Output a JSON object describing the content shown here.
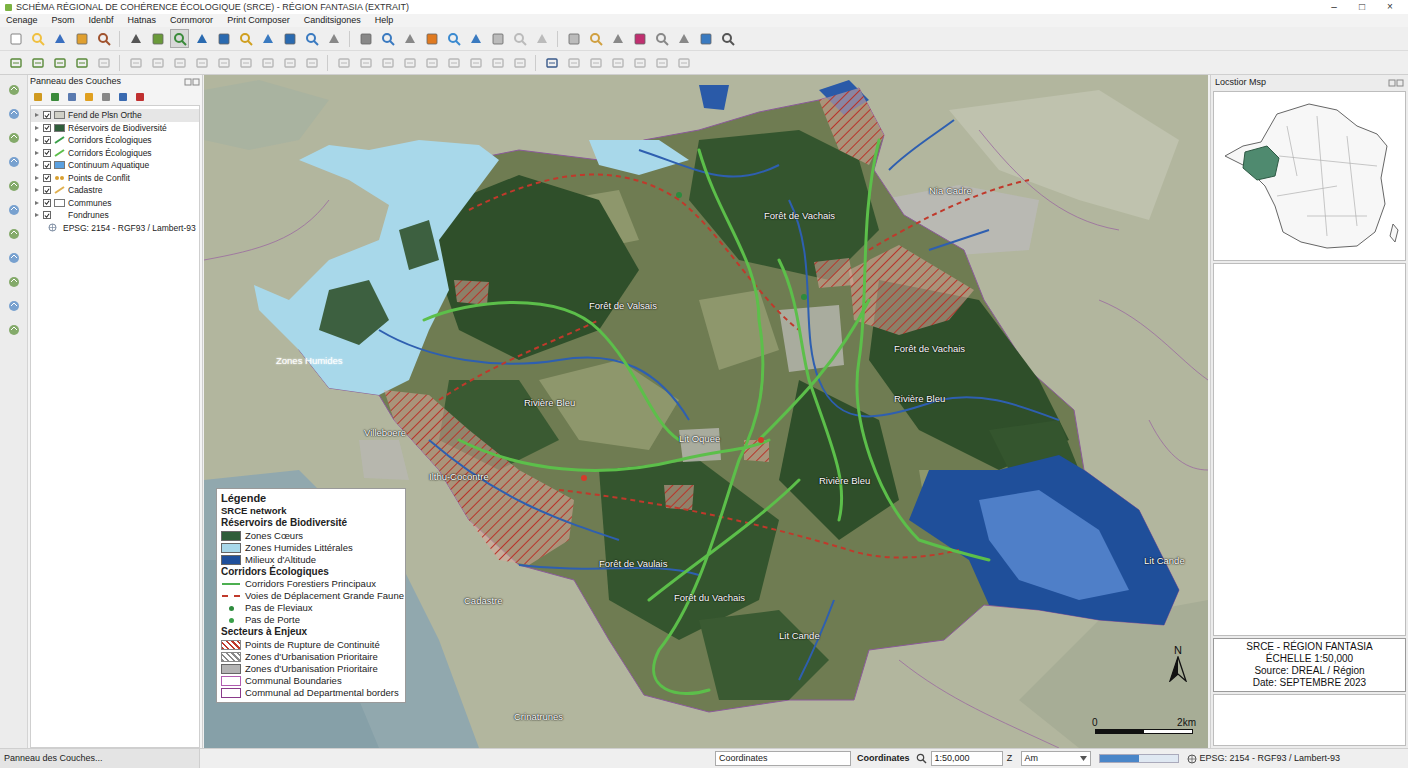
{
  "window": {
    "title": "SCHÉMA RÉGIONAL DE COHÉRENCE ÉCOLOGIQUE (SRCE) - RÉGION FANTASIA (EXTRAIT)",
    "controls": [
      "–",
      "□",
      "×"
    ]
  },
  "menu": [
    "Cenage",
    "Psom",
    "Idenbf",
    "Hatnas",
    "Cornmoror",
    "Print Composer",
    "Canditsigones",
    "Help"
  ],
  "layers_panel": {
    "title": "Panneau des Couches",
    "items": [
      {
        "label": "Fend de Plsn Orthe",
        "kind": "fill",
        "checked": true,
        "color": "#cfcfc6"
      },
      {
        "label": "Réservoirs de Biodiversité",
        "kind": "fill",
        "checked": true,
        "color": "#2f5e3a"
      },
      {
        "label": "Corridors Écologiques",
        "kind": "line",
        "checked": true,
        "color": "#3aa04a"
      },
      {
        "label": "Corridors Écologiques",
        "kind": "line",
        "checked": true,
        "color": "#5cbf4a"
      },
      {
        "label": "Continuum Aquatique",
        "kind": "fill",
        "checked": true,
        "color": "#5aa0e0"
      },
      {
        "label": "Points de Conflit",
        "kind": "dot",
        "checked": true,
        "color": "#d9a030"
      },
      {
        "label": "Cadastre",
        "kind": "line",
        "checked": true,
        "color": "#e0b050"
      },
      {
        "label": "Communes",
        "kind": "fill",
        "checked": true,
        "color": "#ffffff"
      },
      {
        "label": "Fondrunes",
        "kind": "plain",
        "checked": true,
        "color": "#ffffff"
      },
      {
        "label": "EPSG: 2154 - RGF93 / Lambert-93",
        "kind": "crs",
        "color": "#7a8aa0"
      }
    ],
    "footer_tab": "Panneau des Couches..."
  },
  "map": {
    "labels": [
      "Zones Humides",
      "Forêt de Vachais",
      "Forêt de Valsais",
      "Forêt de Vachais",
      "Rivière Bleu",
      "Rivière Bleu",
      "Lit Oquee",
      "Villeboere",
      "Ilthu-Cocontre",
      "Forêt de Vaulais",
      "Forêt du Vachais",
      "Lit Cande",
      "Cadastre",
      "Crinatrunes",
      "Nia Cadre",
      "Rivière Bleu",
      "Lit Cande"
    ],
    "legend": {
      "title": "Légende",
      "subtitle": "SRCE network",
      "sections": [
        {
          "title": "Réservoirs de Biodiversité",
          "items": [
            {
              "label": "Zones Cœurs",
              "kind": "fill",
              "color": "#2f5e3a"
            },
            {
              "label": "Zones Humides Littérales",
              "kind": "fill",
              "color": "#a8d8ea"
            },
            {
              "label": "Milieux d'Altitude",
              "kind": "fill",
              "color": "#1f4f9a"
            }
          ]
        },
        {
          "title": "Corridors Écologiques",
          "items": [
            {
              "label": "Corridors Forestiers Principaux",
              "kind": "line",
              "color": "#4caf50"
            },
            {
              "label": "Voies de Déplacement Grande Faune",
              "kind": "dashed",
              "color": "#c0392b"
            },
            {
              "label": "Pas de Fleviaux",
              "kind": "dot",
              "color": "#2e8b3e"
            },
            {
              "label": "Pas de Porte",
              "kind": "dot",
              "color": "#3aa04a"
            }
          ]
        },
        {
          "title": "Secteurs à Enjeux",
          "items": [
            {
              "label": "Points de Rupture de Continuité",
              "kind": "hatch",
              "color": "#c0392b"
            },
            {
              "label": "Zones d'Urbanisation Prioritaire",
              "kind": "hatch",
              "color": "#8a8a8a"
            },
            {
              "label": "Zones d'Urbanisation Prioritaire",
              "kind": "fill",
              "color": "#b4b4b4"
            },
            {
              "label": "Communal Boundaries",
              "kind": "outline",
              "color": "#b05cb0"
            },
            {
              "label": "Communal ad Departmental borders",
              "kind": "outline",
              "color": "#8a3a8a"
            }
          ]
        }
      ]
    },
    "north": "N",
    "scale_bar": {
      "start": "0",
      "end": "2km"
    }
  },
  "location_map": {
    "title": "Locstior Msp"
  },
  "info_box": {
    "lines": [
      "SRCE - RÉGION FANTASIA",
      "ÉCHELLE 1:50,000",
      "Source: DREAL / Région",
      "Date: SEPTEMBRE 2023"
    ]
  },
  "status_bar": {
    "coordinates_input": "Coordinates",
    "coordinates_label": "Coordinates",
    "scale": "1:50,000",
    "scale_lock": "Z",
    "magnifier": "Am",
    "render_level": 0.5,
    "crs": "EPSG: 2154 - RGF93 / Lambert-93"
  }
}
